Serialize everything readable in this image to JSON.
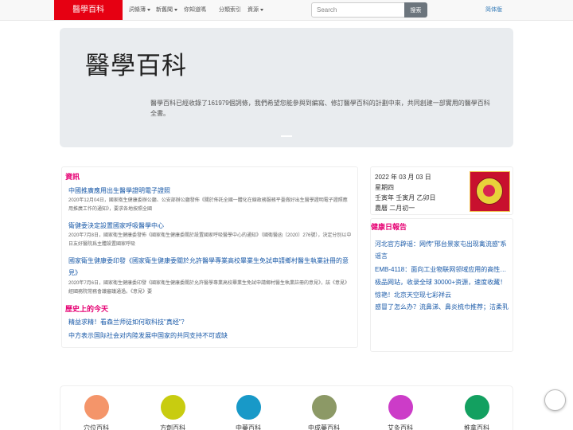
{
  "navbar": {
    "brand": "醫學百科",
    "items": [
      {
        "label": "詞條薄",
        "dropdown": true
      },
      {
        "label": "新舊聞",
        "dropdown": true
      },
      {
        "label": "你知道嗎",
        "dropdown": false
      },
      {
        "label": "分類索引",
        "dropdown": false
      },
      {
        "label": "資源",
        "dropdown": true
      }
    ],
    "search_placeholder": "Search",
    "search_button": "搜索",
    "language": "简体版"
  },
  "jumbotron": {
    "title": "醫學百科",
    "text": "醫學百科已經收錄了161979個詞條，我們希望您能參與到編寫、修訂醫學百科的計劃中來，共同創建一部實用的醫學百科全書。"
  },
  "news": {
    "heading": "資訊",
    "items": [
      {
        "title": "中國推廣應用出生醫學證明電子證照",
        "summary": "2020年12月04日，國家衛生健康委辦公廳、公安部辦公廳發佈《關於佈託全國一體化在線政務服務平臺做好出生醫學證明電子證照應用推廣工作的通知》，要求各地按照全國"
      },
      {
        "title": "衛健委決定設置國家呼吸醫學中心",
        "summary": "2020年7月8日，國家衛生健康委發佈《國家衛生健康委關於設置國家呼吸醫學中心的通知》（國衛醫函〔2020〕276號），決定分別以中日友好醫院爲主體設置國家呼吸"
      },
      {
        "title": "國家衛生健康委印發《國家衛生健康委關於允許醫學專業高校畢業生免試申請鄉村醫生執業註冊的意見》",
        "summary": "2020年7月6日，國家衛生健康委印發《國家衛生健康委關於允許醫學專業高校畢業生免試申請鄉村醫生執業註冊的意見》，該《意見》經國務院常務會議審議通過。《意見》要"
      }
    ]
  },
  "history": {
    "heading": "歷史上的今天",
    "items": [
      "精益求精！看森兰师徒如何取科技\"真经\"？",
      "中方表示国际社会对内陸发展中国家的共同支持不可或缺"
    ]
  },
  "calendar": {
    "date": "2022 年 03 月 03 日",
    "weekday": "星期四",
    "ganzhi": "壬寅年 壬寅月 乙卯日",
    "lunar": "農曆 二月初一"
  },
  "health": {
    "heading": "健康日報告",
    "items": [
      "河北官方辟谣：网传\"邢台景家屯出现禽流感\"系谣言",
      "EMB-4118：面向工业物联网领域应用的高性能…",
      "极品网站，收录全球 30000+资源，速度收藏！",
      "惊艳！北京天空现七彩祥云",
      "感冒了怎么办？流鼻涕、鼻炎梳巾推荐；洁柔乳"
    ]
  },
  "categories": [
    {
      "label": "穴位百科",
      "color": "#f4956a"
    },
    {
      "label": "方劑百科",
      "color": "#c8cc10"
    },
    {
      "label": "中藥百科",
      "color": "#1899c8"
    },
    {
      "label": "中成藥百科",
      "color": "#8c9966"
    },
    {
      "label": "艾灸百科",
      "color": "#cc3cc8"
    },
    {
      "label": "推拿百科",
      "color": "#13a060"
    }
  ]
}
